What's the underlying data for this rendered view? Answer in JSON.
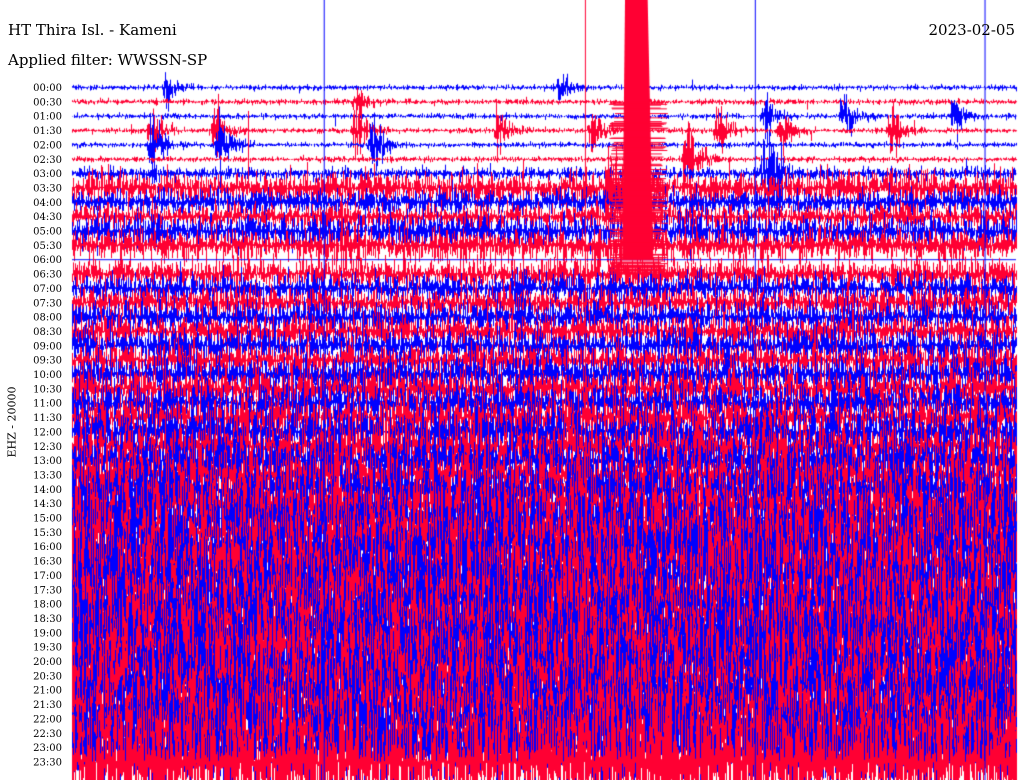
{
  "header": {
    "station": "HT Thira Isl. - Kameni",
    "date": "2023-02-05",
    "filter_text": "Applied filter: WWSSN-SP"
  },
  "channel_label": "EHZ - 20000",
  "colors": {
    "even_trace": "#0000ff",
    "odd_trace": "#ff0033",
    "background": "#ffffff",
    "marker": "#0000ff"
  },
  "chart_data": {
    "type": "helicorder",
    "title": "HT Thira Isl. - Kameni",
    "ylabel": "EHZ - 20000",
    "trace_minutes": 30,
    "row_labels": [
      "00:00",
      "00:30",
      "01:00",
      "01:30",
      "02:00",
      "02:30",
      "03:00",
      "03:30",
      "04:00",
      "04:30",
      "05:00",
      "05:30",
      "06:00",
      "06:30",
      "07:00",
      "07:30",
      "08:00",
      "08:30",
      "09:00",
      "09:30",
      "10:00",
      "10:30",
      "11:00",
      "11:30",
      "12:00",
      "12:30",
      "13:00",
      "13:30",
      "14:00",
      "14:30",
      "15:00",
      "15:30",
      "16:00",
      "16:30",
      "17:00",
      "17:30",
      "18:00",
      "18:30",
      "19:00",
      "19:30",
      "20:00",
      "20:30",
      "21:00",
      "21:30",
      "22:00",
      "22:30",
      "23:00",
      "23:30"
    ],
    "noise_level": [
      0.25,
      0.25,
      0.25,
      0.25,
      0.25,
      0.25,
      0.6,
      1.6,
      1.2,
      1.2,
      1.6,
      1.6,
      0,
      1.5,
      1.5,
      1.6,
      1.6,
      1.6,
      1.7,
      1.7,
      1.9,
      2.0,
      2.0,
      2.2,
      2.4,
      2.6,
      2.8,
      3.0,
      3.3,
      3.6,
      3.8,
      4.0,
      4.2,
      4.3,
      4.4,
      4.4,
      4.4,
      4.4,
      4.4,
      4.4,
      4.4,
      4.4,
      4.3,
      4.2,
      4.1,
      4.1,
      4.4,
      6.0
    ],
    "gap_rows": [
      "06:00"
    ],
    "events": [
      {
        "row": "00:00",
        "minute": 3.0,
        "amp": 2.0
      },
      {
        "row": "00:00",
        "minute": 15.5,
        "amp": 1.6
      },
      {
        "row": "00:30",
        "minute": 9.0,
        "amp": 1.8
      },
      {
        "row": "01:00",
        "minute": 22.0,
        "amp": 2.5
      },
      {
        "row": "01:00",
        "minute": 24.5,
        "amp": 2.6
      },
      {
        "row": "01:00",
        "minute": 28.0,
        "amp": 2.2
      },
      {
        "row": "01:30",
        "minute": 2.5,
        "amp": 3.0
      },
      {
        "row": "01:30",
        "minute": 4.5,
        "amp": 3.2
      },
      {
        "row": "01:30",
        "minute": 9.0,
        "amp": 3.4
      },
      {
        "row": "01:30",
        "minute": 13.5,
        "amp": 2.4
      },
      {
        "row": "01:30",
        "minute": 16.5,
        "amp": 2.8
      },
      {
        "row": "01:30",
        "minute": 20.5,
        "amp": 3.2
      },
      {
        "row": "01:30",
        "minute": 22.5,
        "amp": 3.0
      },
      {
        "row": "01:30",
        "minute": 26.0,
        "amp": 3.0
      },
      {
        "row": "02:00",
        "minute": 2.5,
        "amp": 3.6
      },
      {
        "row": "02:00",
        "minute": 4.6,
        "amp": 3.8
      },
      {
        "row": "02:00",
        "minute": 9.5,
        "amp": 3.5
      },
      {
        "row": "02:30",
        "minute": 19.5,
        "amp": 6.0
      },
      {
        "row": "03:00",
        "minute": 22.0,
        "amp": 6.0
      },
      {
        "row": "03:30",
        "minute": 17.6,
        "amp": 3.2
      },
      {
        "row": "03:30",
        "minute": 17.0,
        "amp": 4.0
      },
      {
        "row": "05:30",
        "minute": 8.5,
        "amp": 2.4
      }
    ],
    "quake": {
      "start_row": "00:30",
      "end_row": "06:30",
      "minute": 17.8,
      "width_minutes": 0.9
    },
    "lines": [
      {
        "minute": 8.0,
        "color": "#0000ff"
      },
      {
        "minute": 16.3,
        "color": "#ff0033"
      },
      {
        "minute": 21.7,
        "color": "#0000ff"
      },
      {
        "minute": 29.0,
        "color": "#0000ff"
      }
    ]
  }
}
